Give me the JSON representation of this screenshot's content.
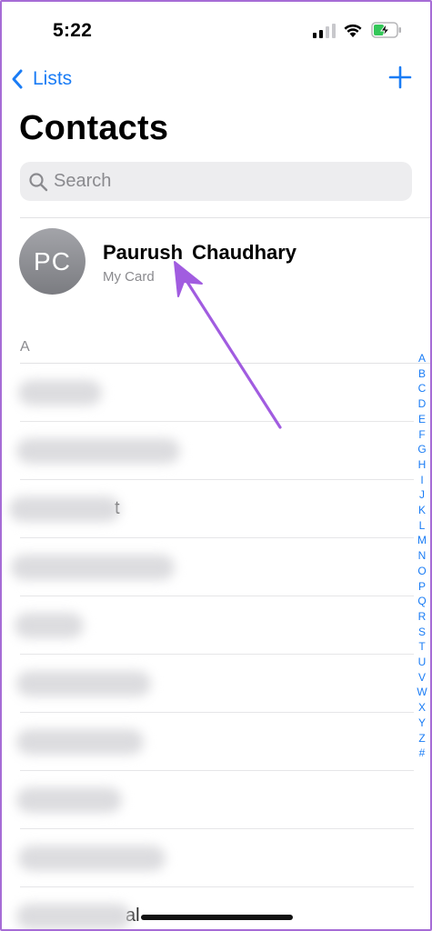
{
  "status_bar": {
    "time": "5:22"
  },
  "nav": {
    "back_label": "Lists",
    "add_icon": "plus-icon"
  },
  "title": "Contacts",
  "search": {
    "placeholder": "Search"
  },
  "my_card": {
    "initials": "PC",
    "name": "Paurush Chaudhary",
    "subtitle": "My Card"
  },
  "section": {
    "header": "A"
  },
  "contacts": [
    {
      "visible_text": "",
      "blurred": true
    },
    {
      "visible_text": "",
      "blurred": true
    },
    {
      "visible_text": "t",
      "blurred": true
    },
    {
      "visible_text": "",
      "blurred": true
    },
    {
      "visible_text": "",
      "blurred": true
    },
    {
      "visible_text": "",
      "blurred": true
    },
    {
      "visible_text": "",
      "blurred": true
    },
    {
      "visible_text": "",
      "blurred": true
    },
    {
      "visible_text": "",
      "blurred": true
    },
    {
      "visible_text": "al",
      "blurred": true
    }
  ],
  "index_letters": [
    "A",
    "B",
    "C",
    "D",
    "E",
    "F",
    "G",
    "H",
    "I",
    "J",
    "K",
    "L",
    "M",
    "N",
    "O",
    "P",
    "Q",
    "R",
    "S",
    "T",
    "U",
    "V",
    "W",
    "X",
    "Y",
    "Z",
    "#"
  ],
  "colors": {
    "accent": "#1a7cf5",
    "annotation_arrow": "#a15ce0",
    "frame": "#a66cd6"
  }
}
